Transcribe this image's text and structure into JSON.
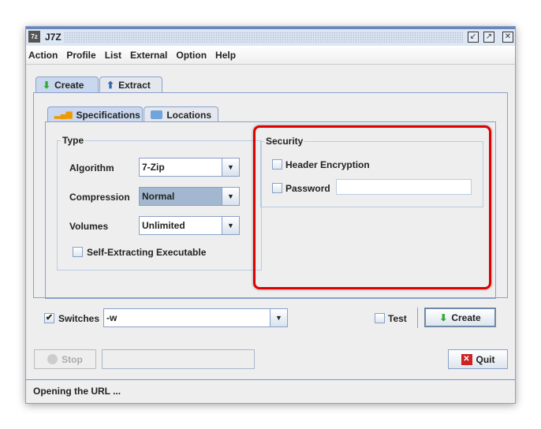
{
  "window": {
    "title": "J7Z",
    "app_icon": "7z"
  },
  "menu": [
    "Action",
    "Profile",
    "List",
    "External",
    "Option",
    "Help"
  ],
  "tabs": {
    "main": [
      {
        "label": "Create",
        "selected": true
      },
      {
        "label": "Extract",
        "selected": false
      }
    ],
    "sub": [
      {
        "label": "Specifications",
        "selected": true
      },
      {
        "label": "Locations",
        "selected": false
      }
    ]
  },
  "type_group": {
    "title": "Type",
    "algorithm_label": "Algorithm",
    "algorithm": "7-Zip",
    "compression_label": "Compression",
    "compression": "Normal",
    "volumes_label": "Volumes",
    "volumes": "Unlimited",
    "sfx_label": "Self-Extracting Executable",
    "sfx_checked": false
  },
  "security_group": {
    "title": "Security",
    "header_encryption_label": "Header Encryption",
    "header_encryption_checked": false,
    "password_label": "Password",
    "password_checked": false,
    "password_value": ""
  },
  "highlight_color": "#e00000",
  "bottom": {
    "switches_label": "Switches",
    "switches_checked": true,
    "switches_value": "-w",
    "test_label": "Test",
    "test_checked": false,
    "create_label": "Create",
    "stop_label": "Stop",
    "progress_text": "",
    "quit_label": "Quit"
  },
  "status": "Opening the URL ..."
}
